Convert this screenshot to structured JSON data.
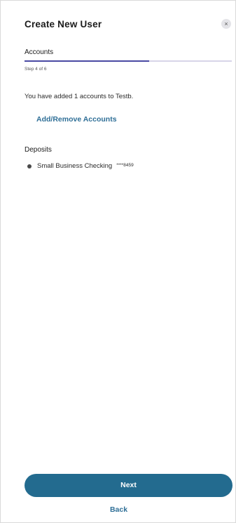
{
  "dialog": {
    "title": "Create New User",
    "close_icon": "close-icon",
    "close_glyph": "×"
  },
  "wizard": {
    "step_label": "Accounts",
    "step_counter": "Step 4 of 6",
    "progress_fraction": 0.6,
    "progress_color": "#4a4aa3"
  },
  "summary": {
    "text": "You have added 1 accounts to Testb."
  },
  "actions": {
    "manage_accounts_label": "Add/Remove Accounts",
    "next_label": "Next",
    "back_label": "Back",
    "primary_color": "#236b8f"
  },
  "deposits": {
    "heading": "Deposits",
    "items": [
      {
        "name": "Small Business Checking",
        "masked_number": "****8459"
      }
    ]
  }
}
